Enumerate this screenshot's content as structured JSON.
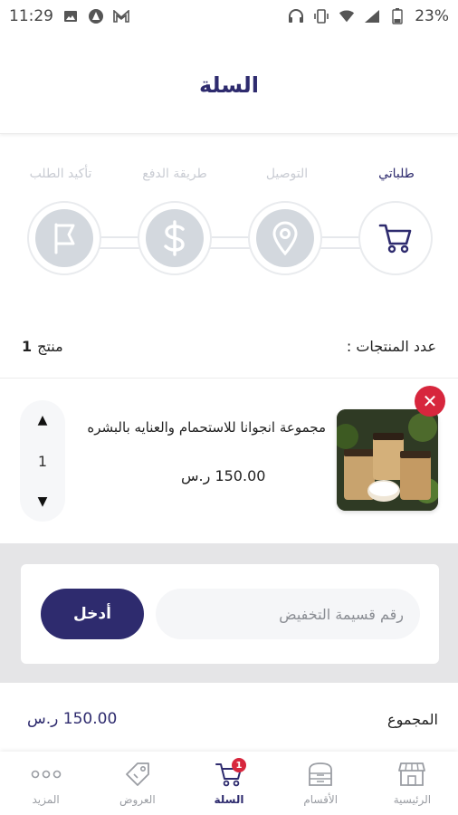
{
  "status_bar": {
    "time": "11:29",
    "battery": "23%"
  },
  "header": {
    "title": "السلة"
  },
  "steps": [
    {
      "label": "طلباتي",
      "icon": "cart-icon",
      "active": true
    },
    {
      "label": "التوصيل",
      "icon": "location-pin-icon",
      "active": false
    },
    {
      "label": "طريقة الدفع",
      "icon": "dollar-icon",
      "active": false
    },
    {
      "label": "تأكيد الطلب",
      "icon": "flag-icon",
      "active": false
    }
  ],
  "cart_summary": {
    "count_label": "عدد المنتجات :",
    "count_number": "1",
    "count_unit": "منتج"
  },
  "items": [
    {
      "name": "مجموعة انجوانا للاستحمام والعنايه بالبشره",
      "price": "150.00 ر.س",
      "quantity": "1"
    }
  ],
  "coupon": {
    "placeholder": "رقم قسيمة التخفيض",
    "apply_label": "أدخل"
  },
  "total": {
    "label": "المجموع",
    "value": "150.00 ر.س"
  },
  "bottom_nav": {
    "more": "المزيد",
    "offers": "العروض",
    "cart": "السلة",
    "cart_badge": "1",
    "categories": "الأقسام",
    "home": "الرئيسية"
  },
  "colors": {
    "primary": "#2e2b6e",
    "danger": "#d7263d",
    "step_inactive": "#d3d8de",
    "coupon_bg": "#e5e5e7"
  }
}
